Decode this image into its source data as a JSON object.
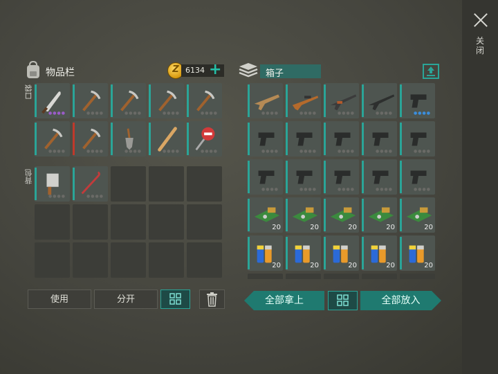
{
  "close_label": "关闭",
  "inventory": {
    "title": "物品栏",
    "pocket_label": "口袋",
    "backpack_label": "背包"
  },
  "coins": {
    "value": "6134",
    "symbol": "Z",
    "plus": "+"
  },
  "box": {
    "title": "箱子"
  },
  "left_buttons": {
    "use": "使用",
    "split": "分开"
  },
  "right_buttons": {
    "take_all": "全部拿上",
    "put_all": "全部放入"
  },
  "colors": {
    "accent": "#2aa598",
    "panel": "#3c3d38",
    "background": "#48483f"
  },
  "pocket_items": [
    {
      "name": "machete",
      "icon": "machete-icon",
      "durability_dots": "purple"
    },
    {
      "name": "pickaxe",
      "icon": "pickaxe-icon"
    },
    {
      "name": "pickaxe",
      "icon": "pickaxe-icon"
    },
    {
      "name": "pickaxe",
      "icon": "pickaxe-icon"
    },
    {
      "name": "pickaxe",
      "icon": "pickaxe-icon"
    },
    {
      "name": "pickaxe",
      "icon": "pickaxe-icon"
    },
    {
      "name": "pickaxe",
      "icon": "pickaxe-icon",
      "bar": "red"
    },
    {
      "name": "shovel",
      "icon": "shovel-icon"
    },
    {
      "name": "baseball bat",
      "icon": "bat-icon"
    },
    {
      "name": "stop sign",
      "icon": "stop-sign-icon"
    }
  ],
  "backpack_items": [
    {
      "name": "cleaver",
      "icon": "cleaver-icon"
    },
    {
      "name": "crowbar",
      "icon": "crowbar-icon"
    }
  ],
  "box_items": [
    {
      "name": "assault rifle",
      "icon": "scar-rifle-icon"
    },
    {
      "name": "hunting rifle",
      "icon": "rifle-icon"
    },
    {
      "name": "AK rifle",
      "icon": "ak-rifle-icon"
    },
    {
      "name": "M16 rifle",
      "icon": "m16-rifle-icon"
    },
    {
      "name": "pistol",
      "icon": "pistol-icon",
      "durability_dots": "blue"
    },
    {
      "name": "pistol",
      "icon": "pistol-icon"
    },
    {
      "name": "pistol",
      "icon": "pistol-icon"
    },
    {
      "name": "pistol",
      "icon": "pistol-icon"
    },
    {
      "name": "pistol",
      "icon": "pistol-icon"
    },
    {
      "name": "pistol",
      "icon": "pistol-icon"
    },
    {
      "name": "pistol",
      "icon": "pistol-icon"
    },
    {
      "name": "pistol",
      "icon": "pistol-icon"
    },
    {
      "name": "pistol",
      "icon": "pistol-icon"
    },
    {
      "name": "pistol",
      "icon": "pistol-icon"
    },
    {
      "name": "pistol",
      "icon": "pistol-icon"
    },
    {
      "name": "circuit board",
      "icon": "circuit-board-icon",
      "count": "20"
    },
    {
      "name": "circuit board",
      "icon": "circuit-board-icon",
      "count": "20"
    },
    {
      "name": "circuit board",
      "icon": "circuit-board-icon",
      "count": "20"
    },
    {
      "name": "circuit board",
      "icon": "circuit-board-icon",
      "count": "20"
    },
    {
      "name": "circuit board",
      "icon": "circuit-board-icon",
      "count": "20"
    },
    {
      "name": "batteries",
      "icon": "battery-icon",
      "count": "20"
    },
    {
      "name": "batteries",
      "icon": "battery-icon",
      "count": "20"
    },
    {
      "name": "batteries",
      "icon": "battery-icon",
      "count": "20"
    },
    {
      "name": "batteries",
      "icon": "battery-icon",
      "count": "20"
    },
    {
      "name": "batteries",
      "icon": "battery-icon",
      "count": "20"
    }
  ]
}
